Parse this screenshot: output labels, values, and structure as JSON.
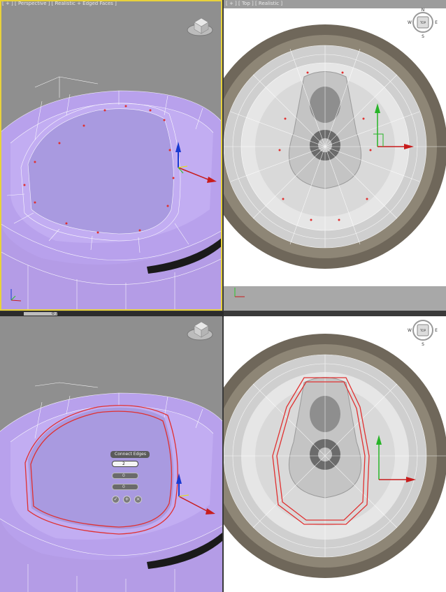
{
  "viewports": {
    "top_left_label": "[ + ] [ Perspective ] [ Realistic + Edged Faces ]",
    "top_right_label": "[ + ] [ Top ] [ Realistic ]",
    "bottom_left_label": "",
    "bottom_right_label": ""
  },
  "viewcube": {
    "n": "N",
    "s": "S",
    "e": "E",
    "w": "W",
    "face": "TOP"
  },
  "timeline": {
    "value": "0 / 100"
  },
  "caddy": {
    "title": "Connect Edges",
    "segments": "2",
    "pinch": "0",
    "slide": "0",
    "ok_icon": "check-icon",
    "apply_icon": "plus-icon",
    "cancel_icon": "x-icon"
  },
  "colors": {
    "active_viewport": "#e8d23a",
    "poly": "#b9a0ee",
    "edge_selected": "#e03030"
  }
}
